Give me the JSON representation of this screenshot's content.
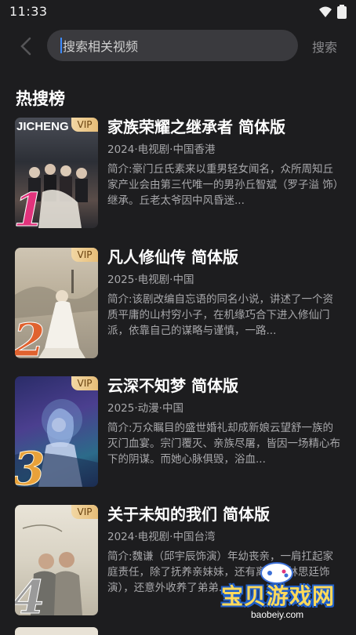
{
  "status_bar": {
    "time": "11:33"
  },
  "search": {
    "placeholder": "搜索相关视频",
    "button_label": "搜索"
  },
  "section": {
    "title": "热搜榜"
  },
  "items": [
    {
      "rank": "1",
      "vip": "VIP",
      "poster_text": "JICHENG",
      "title": "家族荣耀之继承者 简体版",
      "meta": "2024·电视剧·中国香港",
      "desc": "简介:豪门丘氏素来以重男轻女闻名，众所周知丘家产业会由第三代唯一的男孙丘智斌（罗子溢 饰）继承。丘老太爷因中风昏迷..."
    },
    {
      "rank": "2",
      "vip": "VIP",
      "title": "凡人修仙传 简体版",
      "meta": "2025·电视剧·中国",
      "desc": "简介:该剧改编自忘语的同名小说，讲述了一个资质平庸的山村穷小子，在机缘巧合下进入修仙门派，依靠自己的谋略与谨慎，一路..."
    },
    {
      "rank": "3",
      "vip": "VIP",
      "title": "云深不知梦 简体版",
      "meta": "2025·动漫·中国",
      "desc": "简介:万众瞩目的盛世婚礼却成新娘云望舒一族的灭门血宴。宗门覆灭、亲族尽屠，皆因一场精心布下的阴谋。而她心脉俱毁，浴血..."
    },
    {
      "rank": "4",
      "vip": "VIP",
      "title": "关于未知的我们 简体版",
      "meta": "2024·电视剧·中国台湾",
      "desc": "简介:魏谦（邱宇辰饰演）年幼丧亲，一肩扛起家庭责任，除了抚养亲妹妹，还有离离（林思廷饰演），还意外收养了弟弟..."
    }
  ],
  "watermark": {
    "text": "宝贝游戏网",
    "sub": "baobeiy.com"
  },
  "colors": {
    "background": "#1d1d1f",
    "vip_gold": "#e6bd78",
    "rank_1": "#e0337c",
    "rank_2": "#e0622f",
    "rank_3": "#e8a13a",
    "rank_4": "#9a9a9a"
  }
}
